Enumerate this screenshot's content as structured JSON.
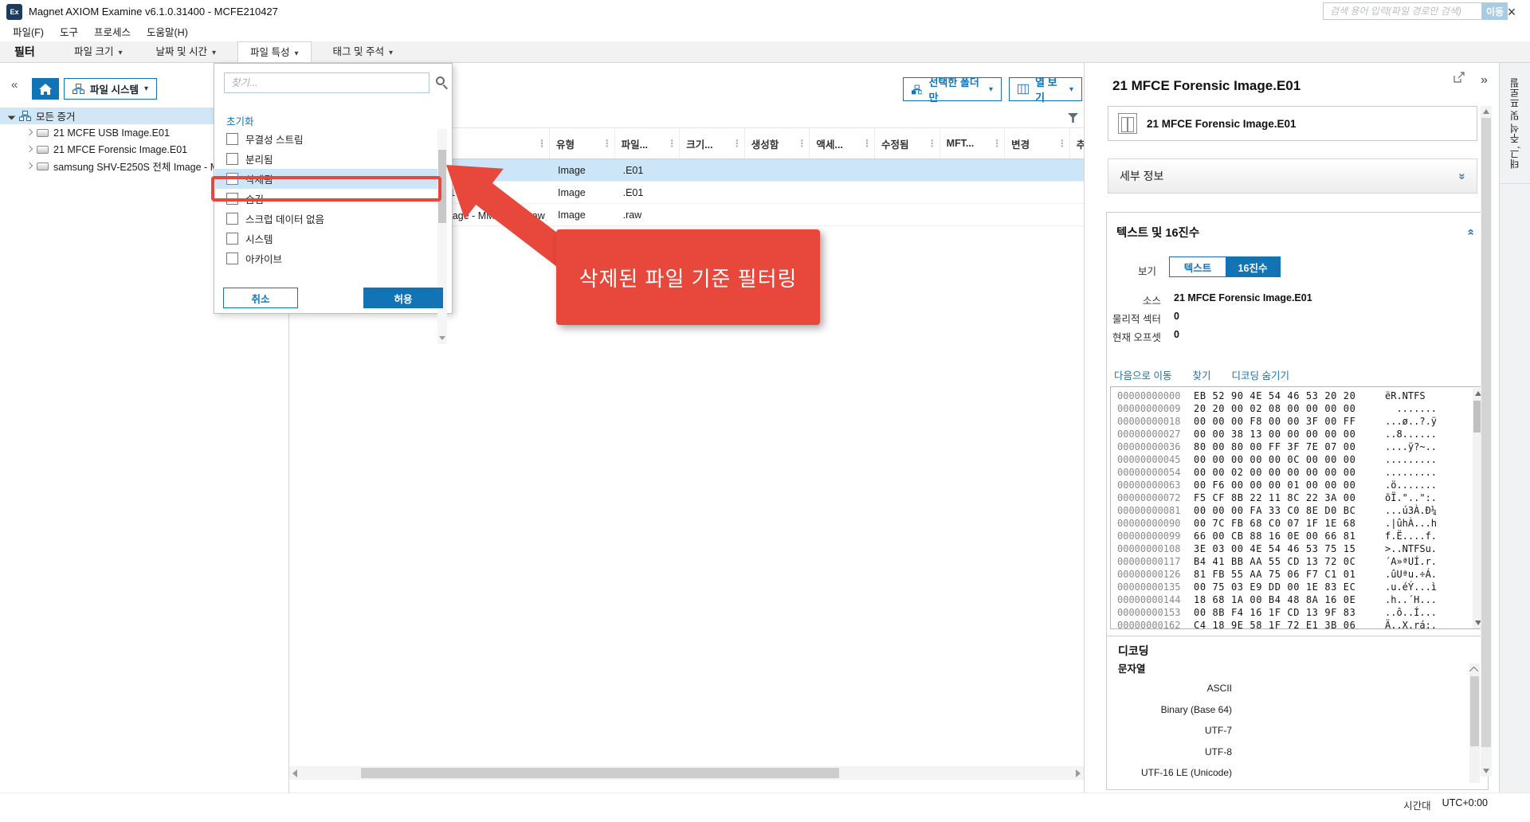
{
  "colors": {
    "accent": "#1273b5",
    "selection": "#cde6f7",
    "annotation": "#e8483b"
  },
  "window": {
    "title": "Magnet AXIOM Examine v6.1.0.31400 - MCFE210427",
    "badge": "Ex"
  },
  "menu": {
    "items": [
      "파일(F)",
      "도구",
      "프로세스",
      "도움말(H)"
    ]
  },
  "filterbar": {
    "label": "필터",
    "tabs": [
      {
        "label": "파일 크기"
      },
      {
        "label": "날짜 및 시간"
      },
      {
        "label": "파일 특성",
        "active": true
      },
      {
        "label": "태그 및 주석"
      }
    ],
    "search": {
      "placeholder": "검색 용어 입력(파일 경로만 검색)",
      "go_label": "이동"
    }
  },
  "sidebar": {
    "view_selector": "파일 시스템",
    "tree": [
      {
        "label": "모든 증거",
        "is_evidence": true,
        "expanded": true,
        "selected": true
      },
      {
        "label": "21 MCFE USB Image.E01",
        "is_child": true
      },
      {
        "label": "21 MFCE Forensic Image.E01",
        "is_child": true
      },
      {
        "label": "samsung SHV-E250S 전체 Image - MMCBLK0.raw",
        "is_child": true
      }
    ]
  },
  "attribute_dropdown": {
    "find_placeholder": "찾기...",
    "reset_label": "초기화",
    "options": [
      {
        "label": "무결성 스트림"
      },
      {
        "label": "분리됨"
      },
      {
        "label": "삭제됨",
        "highlighted": true
      },
      {
        "label": "숨김"
      },
      {
        "label": "스크럽 데이터 없음"
      },
      {
        "label": "시스템"
      },
      {
        "label": "아카이브"
      }
    ],
    "cancel_label": "취소",
    "apply_label": "허용"
  },
  "annotation": {
    "text": "삭제된 파일 기준 필터링"
  },
  "main": {
    "toolbar": {
      "selected_folders_label": "선택한 폴더만",
      "column_view_label": "열 보기"
    },
    "table": {
      "columns": [
        "유형",
        "파일...",
        "크기...",
        "생성함",
        "액세...",
        "수정됨",
        "MFT...",
        "변경",
        "추"
      ],
      "rows": [
        {
          "name": "21 MCFE USB Image.E01",
          "type": "Image",
          "ext": ".E01",
          "selected": true
        },
        {
          "name": "21 MFCE Forensic Image.E01",
          "type": "Image",
          "ext": ".E01"
        },
        {
          "name": "samsung SHV-E250S 전체 Image - MMCBLK0.raw",
          "type": "Image",
          "ext": ".raw"
        }
      ]
    }
  },
  "details": {
    "title": "21 MFCE Forensic Image.E01",
    "evidence_card": "21 MFCE Forensic Image.E01",
    "details_section_label": "세부 정보",
    "hex_section": {
      "title": "텍스트 및 16진수",
      "view_label": "보기",
      "tabs": {
        "text": "텍스트",
        "hex": "16진수"
      },
      "source_label": "소스",
      "source": "21 MFCE Forensic Image.E01",
      "sector_label": "물리적 섹터",
      "sector": "0",
      "offset_label": "현재 오프셋",
      "offset": "0",
      "links": [
        "다음으로 이동",
        "찾기",
        "디코딩 숨기기"
      ],
      "hex_rows": [
        {
          "offset": "00000000000",
          "hex": "EB 52 90 4E 54 46 53 20 20",
          "ascii": "ëR.NTFS  "
        },
        {
          "offset": "00000000009",
          "hex": "20 20 00 02 08 00 00 00 00",
          "ascii": "  ......."
        },
        {
          "offset": "00000000018",
          "hex": "00 00 00 F8 00 00 3F 00 FF",
          "ascii": "...ø..?.ÿ"
        },
        {
          "offset": "00000000027",
          "hex": "00 00 38 13 00 00 00 00 00",
          "ascii": "..8......"
        },
        {
          "offset": "00000000036",
          "hex": "80 00 80 00 FF 3F 7E 07 00",
          "ascii": "....ÿ?~.."
        },
        {
          "offset": "00000000045",
          "hex": "00 00 00 00 00 0C 00 00 00",
          "ascii": "........."
        },
        {
          "offset": "00000000054",
          "hex": "00 00 02 00 00 00 00 00 00",
          "ascii": "........."
        },
        {
          "offset": "00000000063",
          "hex": "00 F6 00 00 00 01 00 00 00",
          "ascii": ".ö......."
        },
        {
          "offset": "00000000072",
          "hex": "F5 CF 8B 22 11 8C 22 3A 00",
          "ascii": "õÏ.\"..\":."
        },
        {
          "offset": "00000000081",
          "hex": "00 00 00 FA 33 C0 8E D0 BC",
          "ascii": "...ú3À.Ð¼"
        },
        {
          "offset": "00000000090",
          "hex": "00 7C FB 68 C0 07 1F 1E 68",
          "ascii": ".|ûhÀ...h"
        },
        {
          "offset": "00000000099",
          "hex": "66 00 CB 88 16 0E 00 66 81",
          "ascii": "f.Ë....f."
        },
        {
          "offset": "00000000108",
          "hex": "3E 03 00 4E 54 46 53 75 15",
          "ascii": ">..NTFSu."
        },
        {
          "offset": "00000000117",
          "hex": "B4 41 BB AA 55 CD 13 72 0C",
          "ascii": "´A»ªUÍ.r."
        },
        {
          "offset": "00000000126",
          "hex": "81 FB 55 AA 75 06 F7 C1 01",
          "ascii": ".ûUªu.÷Á."
        },
        {
          "offset": "00000000135",
          "hex": "00 75 03 E9 DD 00 1E 83 EC",
          "ascii": ".u.éÝ...ì"
        },
        {
          "offset": "00000000144",
          "hex": "18 68 1A 00 B4 48 8A 16 0E",
          "ascii": ".h..´H..."
        },
        {
          "offset": "00000000153",
          "hex": "00 8B F4 16 1F CD 13 9F 83",
          "ascii": "..ô..Í..."
        },
        {
          "offset": "00000000162",
          "hex": "C4 18 9E 58 1F 72 E1 3B 06",
          "ascii": "Ä..X.rá:."
        }
      ]
    },
    "decoding": {
      "title": "디코딩",
      "subtitle": "문자열",
      "encodings": [
        "ASCII",
        "Binary (Base 64)",
        "UTF-7",
        "UTF-8",
        "UTF-16 LE (Unicode)"
      ]
    }
  },
  "right_tab": "태그, 주석 및 프로필",
  "statusbar": {
    "timezone_label": "시간대",
    "timezone_value": "UTC+0:00"
  }
}
